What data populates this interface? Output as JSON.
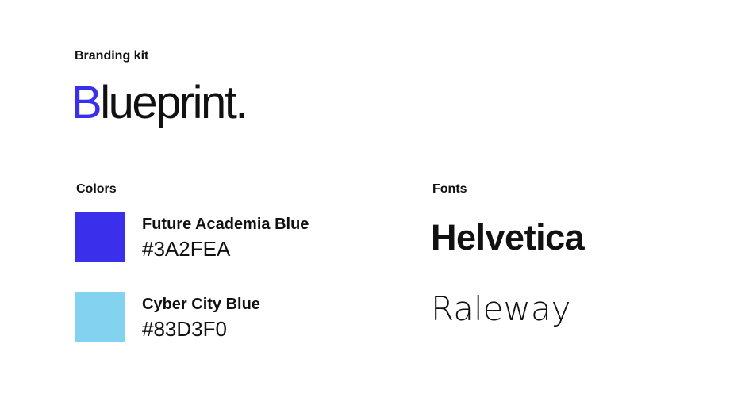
{
  "header": {
    "title": "Branding kit"
  },
  "logo": {
    "initial": "B",
    "rest": "lueprint.",
    "accent_color": "#3A2FEA"
  },
  "colors": {
    "label": "Colors",
    "items": [
      {
        "name": "Future Academia Blue",
        "hex": "#3A2FEA",
        "swatch": "#3A2FEA"
      },
      {
        "name": "Cyber City Blue",
        "hex": "#83D3F0",
        "swatch": "#83D3F0"
      }
    ]
  },
  "fonts": {
    "label": "Fonts",
    "items": [
      {
        "name": "Helvetica"
      },
      {
        "name": "Raleway"
      }
    ]
  }
}
